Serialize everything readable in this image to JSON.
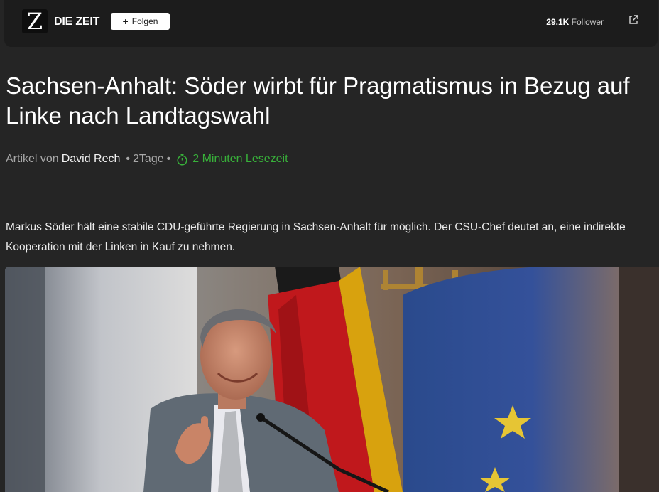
{
  "header": {
    "logo_letter": "Z",
    "publisher": "DIE ZEIT",
    "follow_label": "Folgen",
    "followers_count": "29.1K",
    "followers_label": "Follower"
  },
  "article": {
    "headline": "Sachsen-Anhalt: Söder wirbt für Pragmatismus in Bezug auf Linke nach Landtagswahl",
    "byline_prefix": "Artikel von",
    "author": "David Rech",
    "age": "2Tage",
    "read_time": "2 Minuten Lesezeit",
    "lead": "Markus Söder hält eine stabile CDU-geführte Regierung in Sachsen-Anhalt für möglich. Der CSU-Chef deutet an, eine indirekte Kooperation mit der Linken in Kauf zu nehmen."
  },
  "colors": {
    "background": "#252525",
    "topbar": "#1c1c1c",
    "read_time_accent": "#38b13a"
  }
}
